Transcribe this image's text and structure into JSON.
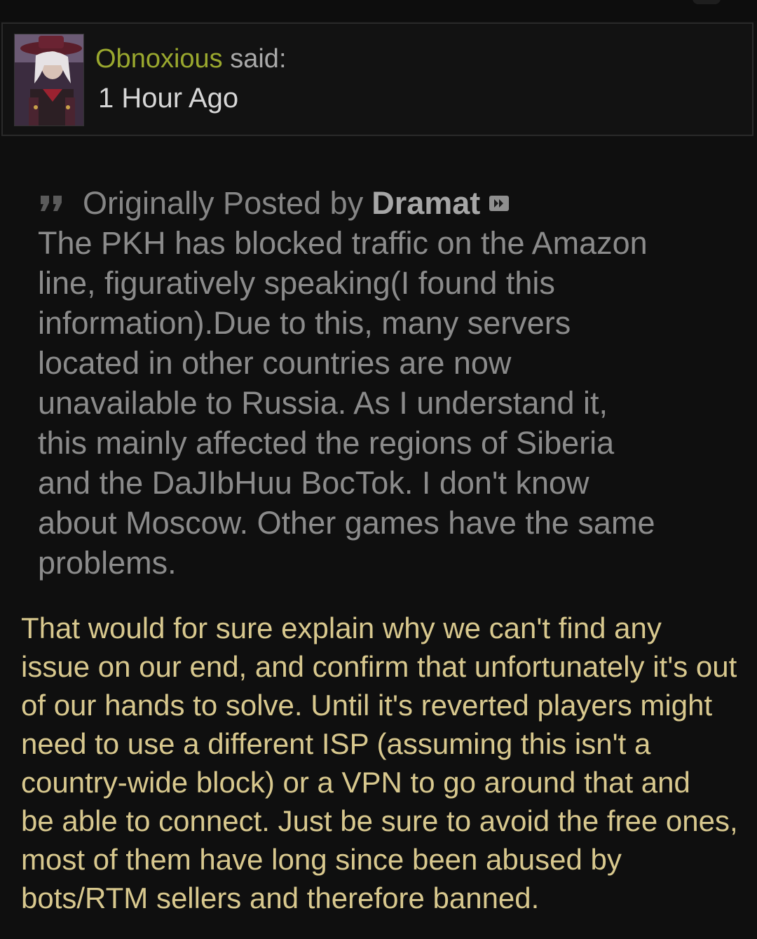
{
  "post": {
    "author": "Obnoxious",
    "said": "said:",
    "timestamp": "1 Hour Ago",
    "avatar_icon": "user-avatar",
    "colors": {
      "author": "#9aa82e",
      "reply_text": "#d8c88e",
      "quote_text": "#8b8b8b",
      "background": "#0f0f0f"
    }
  },
  "quote": {
    "icon": "quote-icon",
    "label": "Originally Posted by",
    "author": "Dramat",
    "jump_icon": "view-post-icon",
    "body": "The PKH has blocked traffic on the Amazon\nline, figuratively speaking(I found this\ninformation).Due to this, many servers\nlocated in other countries are now\nunavailable to Russia. As I understand it,\nthis mainly affected the regions of Siberia\nand the DaJIbHuu BocTok. I don't know\nabout Moscow. Other games have the same\nproblems."
  },
  "reply": {
    "body": "That would for sure explain why we can't find any\nissue on our end, and confirm that unfortunately it's out\nof our hands to solve. Until it's reverted players might\nneed to use a different ISP (assuming this isn't a\ncountry-wide block) or a VPN to go around that and\nbe able to connect. Just be sure to avoid the free ones,\nmost of them have long since been abused by\nbots/RTM sellers and therefore banned."
  }
}
